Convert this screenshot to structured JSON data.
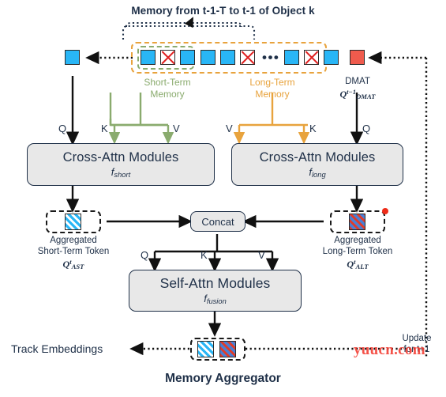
{
  "figure": {
    "top_title": "Memory from t-1-T to t-1 of Object k",
    "bottom_title": "Memory Aggregator"
  },
  "memory_row": {
    "output_token_label": "aggregated-output-token",
    "short_term": {
      "label_line1": "Short-Term",
      "label_line2": "Memory",
      "color": "#8aab6e",
      "tokens": [
        "active",
        "masked",
        "active"
      ]
    },
    "long_term": {
      "label_line1": "Long-Term",
      "label_line2": "Memory",
      "color": "#e8a33d",
      "tokens": [
        "active",
        "active",
        "masked",
        "ellipsis",
        "active",
        "masked",
        "active"
      ],
      "ellipsis": "•••"
    },
    "dmat": {
      "label": "DMAT",
      "formula_base": "Q",
      "formula_sup": "t−1",
      "formula_sub": "DMAT",
      "color": "#ef5b4d"
    }
  },
  "qkv_labels": {
    "short_q": "Q",
    "short_k": "K",
    "short_v": "V",
    "long_v": "V",
    "long_k": "K",
    "long_q": "Q",
    "fusion_q": "Q",
    "fusion_k": "K",
    "fusion_v": "V"
  },
  "modules": {
    "cross_short": {
      "title": "Cross-Attn Modules",
      "fn": "f",
      "fn_sub": "short"
    },
    "cross_long": {
      "title": "Cross-Attn Modules",
      "fn": "f",
      "fn_sub": "long"
    },
    "self_fusion": {
      "title": "Self-Attn Modules",
      "fn": "f",
      "fn_sub": "fusion"
    },
    "concat": {
      "label": "Concat"
    }
  },
  "aggregated": {
    "short": {
      "caption_line1": "Aggregated",
      "caption_line2": "Short-Term Token",
      "formula_base": "Q",
      "formula_sup": "t",
      "formula_sub": "AST"
    },
    "long": {
      "caption_line1": "Aggregated",
      "caption_line2": "Long-Term Token",
      "formula_base": "Q",
      "formula_sup": "t",
      "formula_sub": "ALT"
    }
  },
  "output": {
    "track_embeddings": "Track Embeddings",
    "update_line1": "Update",
    "update_line2": "for t+1"
  },
  "watermark": {
    "text": "yuucn.com",
    "color": "#f4443a"
  },
  "colors": {
    "token_blue": "#29b6f6",
    "token_red": "#ef5b4d",
    "mask_red": "#e02020",
    "green": "#8aab6e",
    "orange": "#e8a33d",
    "ink": "#1f3048",
    "module_fill": "#e8e8e8"
  }
}
